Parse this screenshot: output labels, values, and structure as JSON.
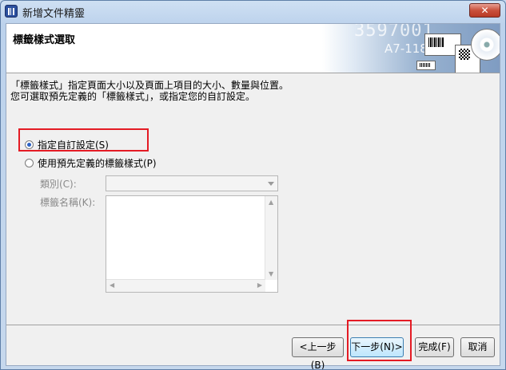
{
  "window": {
    "title": "新增文件精靈",
    "close_label": "✕"
  },
  "header": {
    "title": "標籤樣式選取",
    "banner_number": "3597001",
    "banner_code": "A7-118"
  },
  "description": "「標籤樣式」指定頁面大小以及頁面上項目的大小、數量與位置。您可選取預先定義的「標籤樣式」，或指定您的自訂設定。",
  "options": {
    "custom": {
      "label": "指定自訂設定(S)",
      "checked": true
    },
    "predefined": {
      "label": "使用預先定義的標籤樣式(P)",
      "checked": false
    }
  },
  "category": {
    "label": "類別(C):",
    "value": ""
  },
  "label_name": {
    "label": "標籤名稱(K):"
  },
  "buttons": {
    "back": "<上一步(B)",
    "next": "下一步(N)>",
    "finish": "完成(F)",
    "cancel": "取消"
  },
  "colors": {
    "highlight": "#e41b24",
    "accent": "#2b61c4"
  }
}
